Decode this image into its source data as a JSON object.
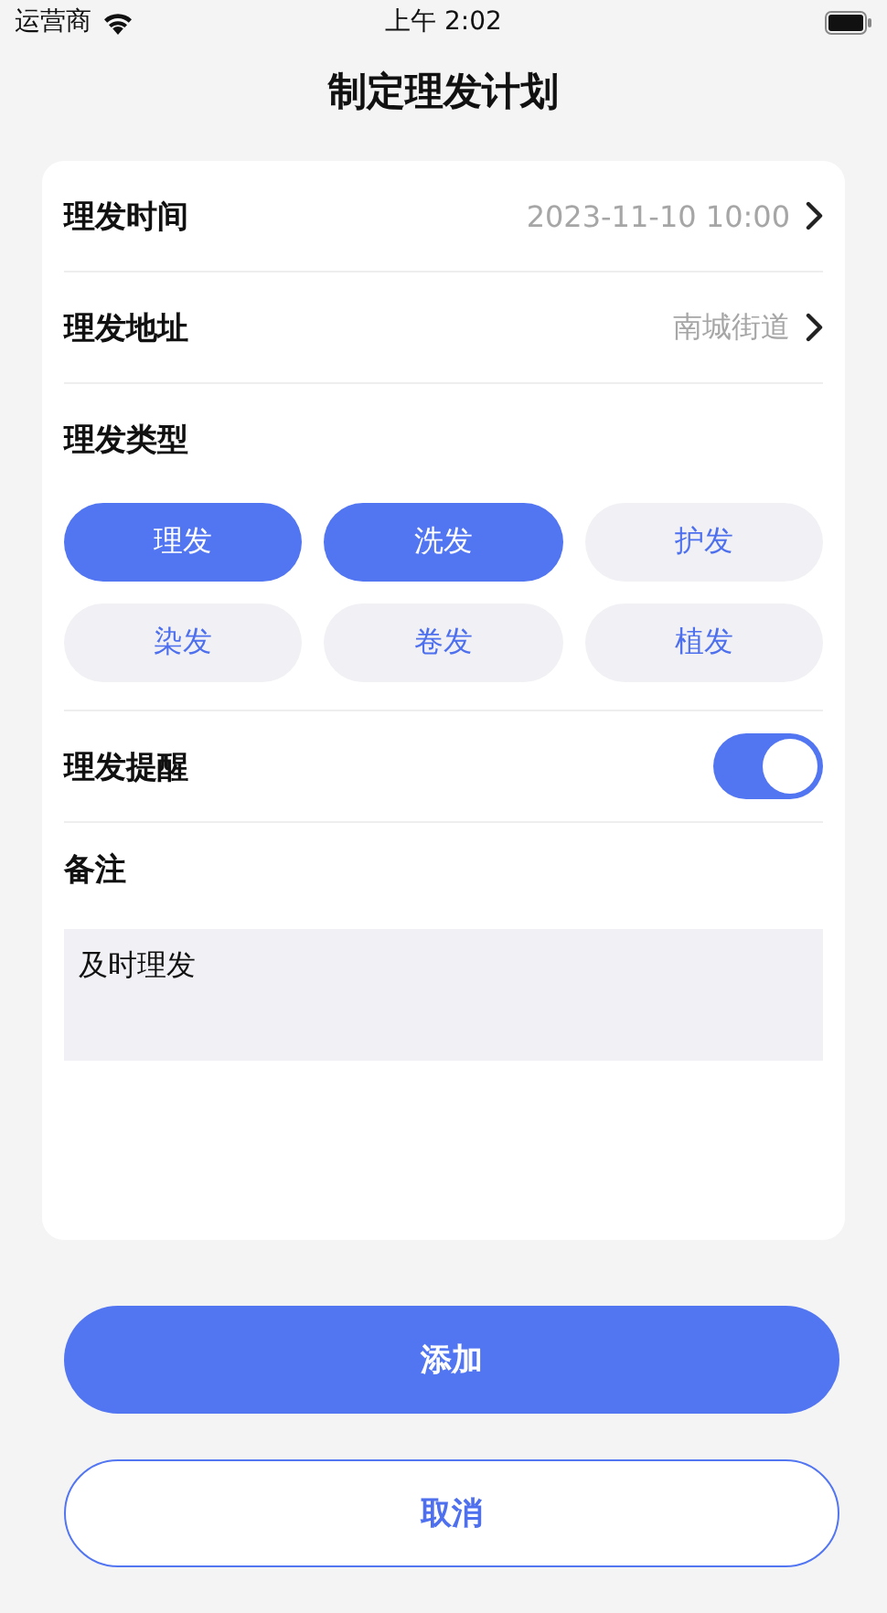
{
  "status_bar": {
    "carrier": "运营商",
    "time": "上午 2:02"
  },
  "title": "制定理发计划",
  "fields": [
    {
      "label": "理发时间",
      "value": "2023-11-10 10:00"
    },
    {
      "label": "理发地址",
      "value": "南城街道"
    }
  ],
  "type_section": {
    "label": "理发类型",
    "options": [
      {
        "label": "理发",
        "selected": true
      },
      {
        "label": "洗发",
        "selected": true
      },
      {
        "label": "护发",
        "selected": false
      },
      {
        "label": "染发",
        "selected": false
      },
      {
        "label": "卷发",
        "selected": false
      },
      {
        "label": "植发",
        "selected": false
      }
    ]
  },
  "reminder": {
    "label": "理发提醒",
    "on": true
  },
  "notes": {
    "label": "备注",
    "value": "及时理发"
  },
  "buttons": [
    {
      "label": "添加",
      "kind": "primary"
    },
    {
      "label": "取消",
      "kind": "secondary"
    }
  ]
}
